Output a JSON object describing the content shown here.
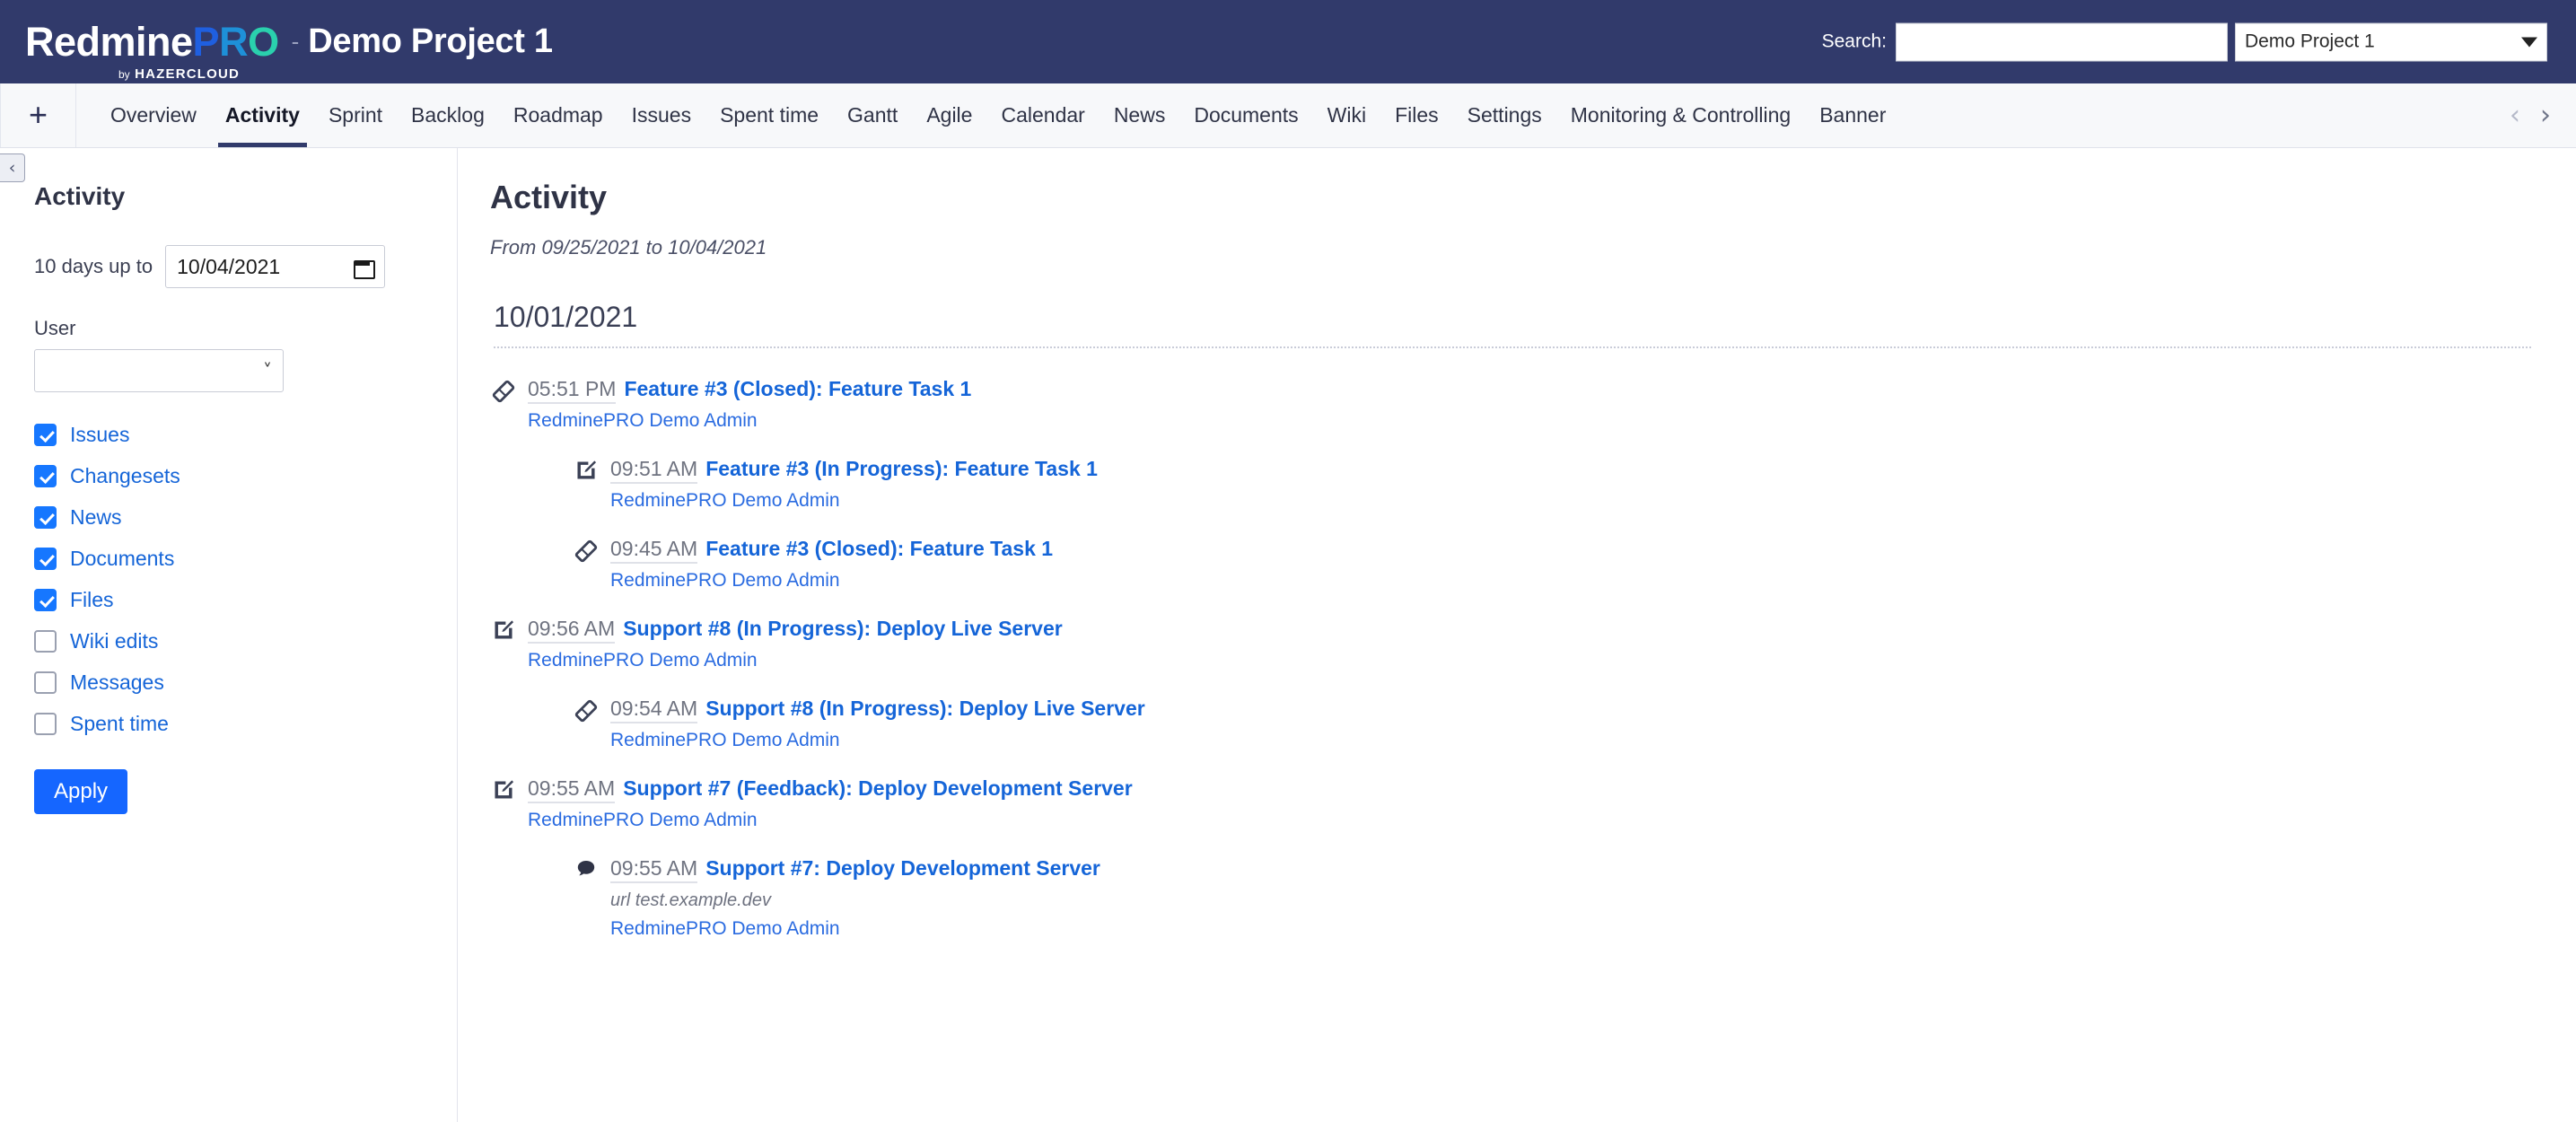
{
  "header": {
    "logo": {
      "part1": "Redmine",
      "part_p": "P",
      "part_r": "R",
      "part_o": "O",
      "by": "by",
      "company": "HAZERCLOUD"
    },
    "title_separator": "-",
    "project_title": "Demo Project 1",
    "search_label": "Search:",
    "search_value": "",
    "search_placeholder": "",
    "project_select_value": "Demo Project 1",
    "brand_color": "#313a6b"
  },
  "tabbar": {
    "add_label": "+",
    "scroll_left": "‹",
    "scroll_right": "›",
    "active_tab": "Activity",
    "tabs": [
      {
        "label": "Overview"
      },
      {
        "label": "Activity"
      },
      {
        "label": "Sprint"
      },
      {
        "label": "Backlog"
      },
      {
        "label": "Roadmap"
      },
      {
        "label": "Issues"
      },
      {
        "label": "Spent time"
      },
      {
        "label": "Gantt"
      },
      {
        "label": "Agile"
      },
      {
        "label": "Calendar"
      },
      {
        "label": "News"
      },
      {
        "label": "Documents"
      },
      {
        "label": "Wiki"
      },
      {
        "label": "Files"
      },
      {
        "label": "Settings"
      },
      {
        "label": "Monitoring & Controlling"
      },
      {
        "label": "Banner"
      }
    ]
  },
  "sidebar": {
    "collapse_icon": "‹",
    "title": "Activity",
    "days_label": "10 days up to",
    "date_value": "10/04/2021",
    "user_label": "User",
    "user_value": "",
    "apply_label": "Apply",
    "filters": [
      {
        "label": "Issues",
        "checked": true
      },
      {
        "label": "Changesets",
        "checked": true
      },
      {
        "label": "News",
        "checked": true
      },
      {
        "label": "Documents",
        "checked": true
      },
      {
        "label": "Files",
        "checked": true
      },
      {
        "label": "Wiki edits",
        "checked": false
      },
      {
        "label": "Messages",
        "checked": false
      },
      {
        "label": "Spent time",
        "checked": false
      }
    ]
  },
  "main": {
    "title": "Activity",
    "range": "From 09/25/2021 to 10/04/2021",
    "day_heading": "10/01/2021",
    "events": [
      {
        "icon": "ticket-icon",
        "indent": false,
        "time": "05:51 PM",
        "link": "Feature #3 (Closed): Feature Task 1",
        "description": "",
        "author": "RedminePRO Demo Admin"
      },
      {
        "icon": "edit-icon",
        "indent": true,
        "time": "09:51 AM",
        "link": "Feature #3 (In Progress): Feature Task 1",
        "description": "",
        "author": "RedminePRO Demo Admin"
      },
      {
        "icon": "ticket-icon",
        "indent": true,
        "time": "09:45 AM",
        "link": "Feature #3 (Closed): Feature Task 1",
        "description": "",
        "author": "RedminePRO Demo Admin"
      },
      {
        "icon": "edit-icon",
        "indent": false,
        "time": "09:56 AM",
        "link": "Support #8 (In Progress): Deploy Live Server",
        "description": "",
        "author": "RedminePRO Demo Admin"
      },
      {
        "icon": "ticket-icon",
        "indent": true,
        "time": "09:54 AM",
        "link": "Support #8 (In Progress): Deploy Live Server",
        "description": "",
        "author": "RedminePRO Demo Admin"
      },
      {
        "icon": "edit-icon",
        "indent": false,
        "time": "09:55 AM",
        "link": "Support #7 (Feedback): Deploy Development Server",
        "description": "",
        "author": "RedminePRO Demo Admin"
      },
      {
        "icon": "comment-icon",
        "indent": true,
        "time": "09:55 AM",
        "link": "Support #7: Deploy Development Server",
        "description": "url test.example.dev",
        "author": "RedminePRO Demo Admin"
      }
    ]
  },
  "colors": {
    "brand_navy": "#313a6b",
    "link_blue": "#1565d8",
    "accent_blue": "#1566ff",
    "logo_blue": "#1f5fe0",
    "logo_teal": "#2ad0ad"
  }
}
